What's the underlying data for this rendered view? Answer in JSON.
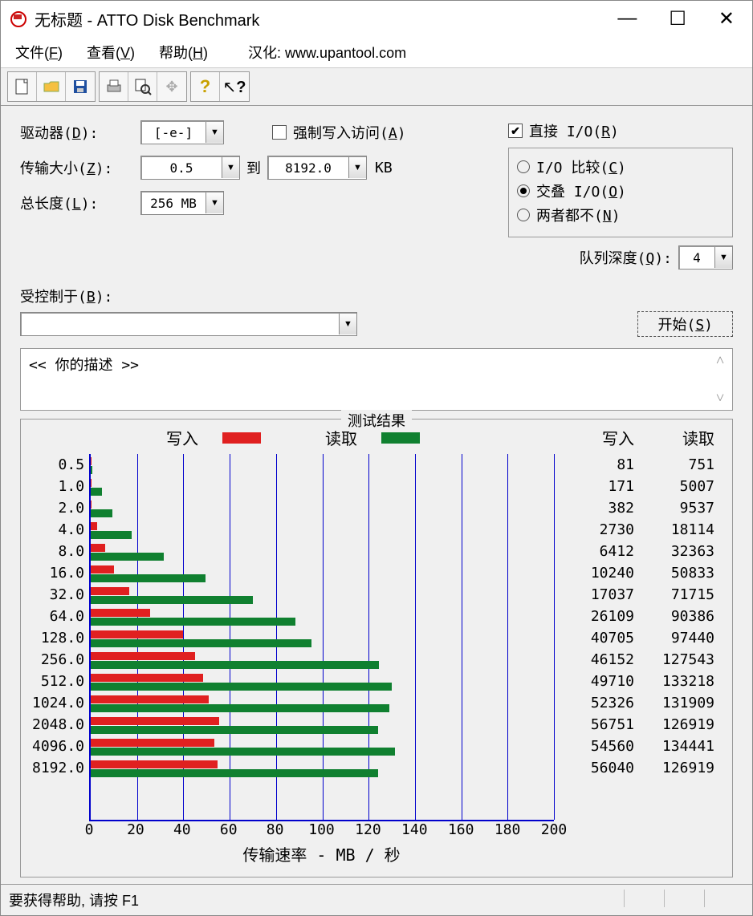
{
  "window": {
    "title": "无标题 - ATTO Disk Benchmark"
  },
  "menu": {
    "file": "文件(F)",
    "view": "查看(V)",
    "help": "帮助(H)",
    "translation": "汉化: www.upantool.com"
  },
  "toolbar_icons": {
    "new": "new-file-icon",
    "open": "open-folder-icon",
    "save": "save-icon",
    "print": "print-icon",
    "preview": "print-preview-icon",
    "move": "move-icon",
    "about": "question-icon",
    "context_help": "context-help-icon"
  },
  "form": {
    "drive_label": "驱动器(D):",
    "drive_value": "[-e-]",
    "transfer_label": "传输大小(Z):",
    "transfer_from": "0.5",
    "transfer_to_label": "到",
    "transfer_to": "8192.0",
    "kb_label": "KB",
    "total_len_label": "总长度(L):",
    "total_len_value": "256 MB",
    "force_write_label": "强制写入访问(A)",
    "direct_io_label": "直接 I/O(R)",
    "radio1": "I/O 比较(C)",
    "radio2": "交叠 I/O(O)",
    "radio3": "两者都不(N)",
    "queue_label": "队列深度(Q):",
    "queue_value": "4",
    "controlled_label": "受控制于(B):",
    "start_label": "开始(S)",
    "desc_text": "<<  你的描述   >>"
  },
  "results": {
    "group_title": "测试结果",
    "write_label": "写入",
    "read_label": "读取",
    "xaxis_label": "传输速率 - MB / 秒",
    "header_write": "写入",
    "header_read": "读取"
  },
  "chart_data": {
    "type": "bar",
    "orientation": "horizontal",
    "categories": [
      "0.5",
      "1.0",
      "2.0",
      "4.0",
      "8.0",
      "16.0",
      "32.0",
      "64.0",
      "128.0",
      "256.0",
      "512.0",
      "1024.0",
      "2048.0",
      "4096.0",
      "8192.0"
    ],
    "series": [
      {
        "name": "写入",
        "color": "#e02020",
        "values_kb": [
          81,
          171,
          382,
          2730,
          6412,
          10240,
          17037,
          26109,
          40705,
          46152,
          49710,
          52326,
          56751,
          54560,
          56040
        ]
      },
      {
        "name": "读取",
        "color": "#108030",
        "values_kb": [
          751,
          5007,
          9537,
          18114,
          32363,
          50833,
          71715,
          90386,
          97440,
          127543,
          133218,
          131909,
          126919,
          134441,
          126919
        ]
      }
    ],
    "xlabel": "传输速率 - MB / 秒",
    "ylabel": "",
    "xlim": [
      0,
      200
    ],
    "xticks": [
      0,
      20,
      40,
      60,
      80,
      100,
      120,
      140,
      160,
      180,
      200
    ],
    "unit_note": "values_kb are KB/s; bars plotted as MB/s = value/1024"
  },
  "status": {
    "help_text": "要获得帮助, 请按 F1"
  }
}
